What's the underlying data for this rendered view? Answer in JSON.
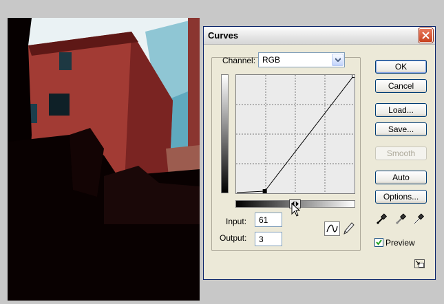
{
  "dialog": {
    "title": "Curves",
    "channel_label": "Channel:",
    "channel_value": "RGB",
    "input_label": "Input:",
    "input_value": "61",
    "output_label": "Output:",
    "output_value": "3",
    "preview_label": "Preview",
    "preview_checked": true
  },
  "buttons": {
    "ok": "OK",
    "cancel": "Cancel",
    "load": "Load...",
    "save": "Save...",
    "smooth": "Smooth",
    "auto": "Auto",
    "options": "Options..."
  },
  "curve": {
    "points": [
      [
        0,
        0
      ],
      [
        61,
        3
      ],
      [
        255,
        255
      ]
    ],
    "selected_point": [
      61,
      3
    ],
    "grid_divisions": 4,
    "input_range": [
      0,
      255
    ],
    "output_range": [
      0,
      255
    ]
  },
  "colors": {
    "dialog_bg": "#ece9d8",
    "button_border": "#003c74",
    "close_button": "#c8421f"
  }
}
